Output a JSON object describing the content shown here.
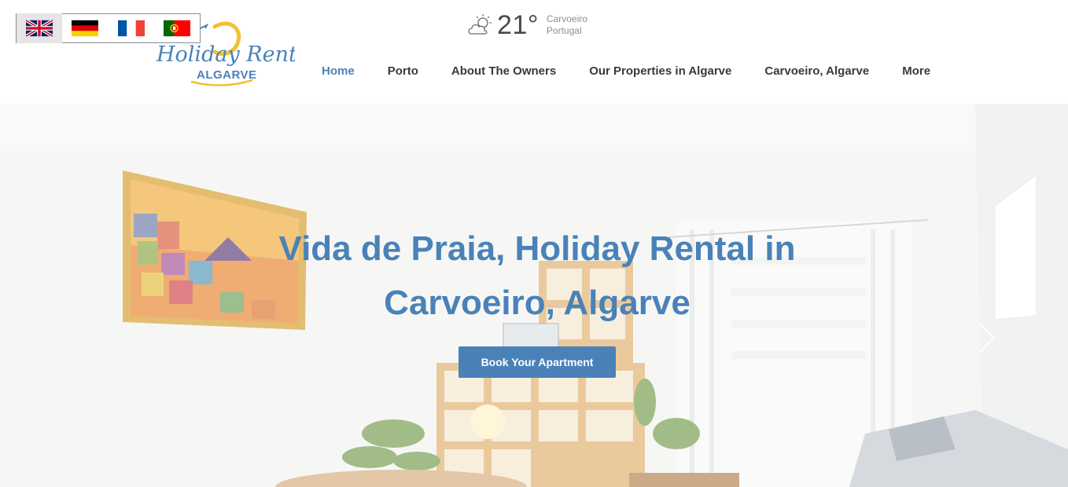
{
  "languages": [
    {
      "name": "English",
      "icon": "uk-flag-icon"
    },
    {
      "name": "Deutsch",
      "icon": "germany-flag-icon"
    },
    {
      "name": "Français",
      "icon": "france-flag-icon"
    },
    {
      "name": "Português",
      "icon": "portugal-flag-icon"
    }
  ],
  "logo": {
    "line1": "Holiday Rental",
    "line2": "ALGARVE"
  },
  "weather": {
    "icon": "partly-cloudy-icon",
    "temperature": "21°",
    "city": "Carvoeiro",
    "country": "Portugal"
  },
  "nav": {
    "items": [
      {
        "label": "Home",
        "active": true
      },
      {
        "label": "Porto"
      },
      {
        "label": "About The Owners"
      },
      {
        "label": "Our Properties in Algarve"
      },
      {
        "label": "Carvoeiro, Algarve"
      },
      {
        "label": "More"
      }
    ]
  },
  "hero": {
    "title_line1": "Vida de Praia, Holiday Rental in",
    "title_line2": "Carvoeiro, Algarve",
    "cta": "Book Your Apartment",
    "next_icon": "chevron-right-icon"
  },
  "colors": {
    "accent": "#4a82b8",
    "nav_text": "#3a3a3a"
  }
}
